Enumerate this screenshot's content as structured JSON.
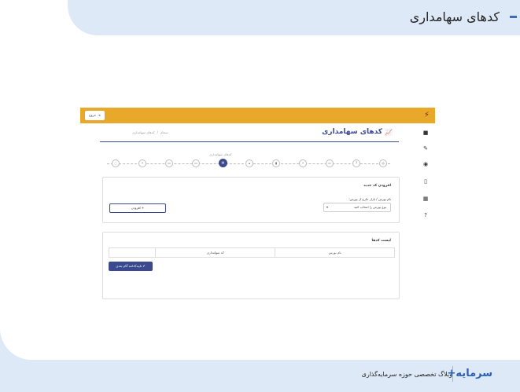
{
  "slide": {
    "title": "کدهای سهامداری",
    "footer_text": "وبلاگ تخصصی حوزه سرمایه‌گذاری",
    "footer_logo": "سرمایه+"
  },
  "app": {
    "topbar": {
      "logout_label": "خروج",
      "logout_icon": "logout-icon",
      "brand_color": "#e8a92b"
    },
    "sidebar": {
      "icons": [
        "book-icon",
        "edit-icon",
        "eye-icon",
        "mobile-icon",
        "building-icon",
        "question-icon"
      ]
    },
    "page": {
      "title": "کدهای سهامداری",
      "breadcrumb": [
        "سجام",
        "کدهای سهامداری"
      ],
      "accent_color": "#3b4a8f"
    },
    "wizard": {
      "active_step_label": "کدهای سهامداری",
      "step_count": 11,
      "active_index": 5
    },
    "add_panel": {
      "title": "افزودن کد جدید",
      "field_label": "نام بورس / بازار خارج از بورس:",
      "select_value": "نوع بورس را انتخاب کنید",
      "add_button": "افزودن"
    },
    "list_panel": {
      "title": "لیست کدها",
      "columns": [
        "نام بورس",
        "کد سهامداری",
        ""
      ],
      "confirm_button": "تایید/ادامه گام بعدی"
    }
  }
}
